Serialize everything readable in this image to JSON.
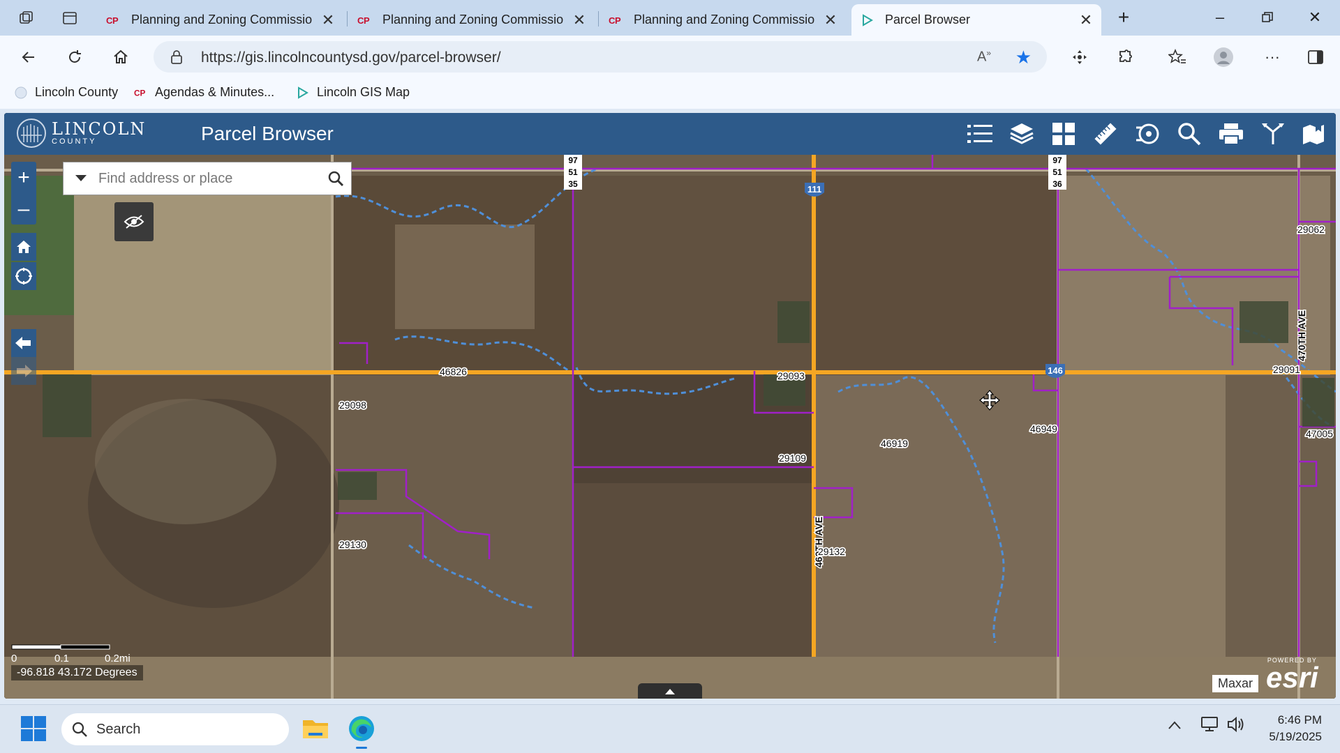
{
  "browser": {
    "tabs": [
      {
        "title": "Planning and Zoning Commissio",
        "favicon": "lincoln-cp-icon",
        "active": false
      },
      {
        "title": "Planning and Zoning Commissio",
        "favicon": "lincoln-cp-icon",
        "active": false
      },
      {
        "title": "Planning and Zoning Commissio",
        "favicon": "lincoln-cp-icon",
        "active": false
      },
      {
        "title": "Parcel Browser",
        "favicon": "gis-icon",
        "active": true
      }
    ],
    "url": "https://gis.lincolncountysd.gov/parcel-browser/",
    "read_aloud": "Aʹʹ",
    "bookmarks": [
      {
        "label": "Lincoln County"
      },
      {
        "label": "Agendas & Minutes..."
      },
      {
        "label": "Lincoln GIS Map"
      }
    ]
  },
  "app": {
    "logo_word": "LINCOLN",
    "logo_sub": "COUNTY",
    "title": "Parcel Browser",
    "header_color": "#2d5a8a"
  },
  "map": {
    "search_placeholder": "Find address or place",
    "parcel_labels": [
      "29098",
      "46826",
      "29093",
      "29062",
      "29091",
      "46949",
      "46919",
      "29109",
      "47005",
      "29130",
      "29132"
    ],
    "road_labels": [
      "469TH AVE",
      "470TH AVE"
    ],
    "shields": [
      "111",
      "146"
    ],
    "section_markers": [
      {
        "line1": "97",
        "line2": "51",
        "line3": "35"
      },
      {
        "line1": "97",
        "line2": "51",
        "line3": "36"
      }
    ],
    "scale": {
      "t0": "0",
      "t1": "0.1",
      "t2": "0.2mi"
    },
    "coordinates": "-96.818 43.172 Degrees",
    "attribution": "Maxar",
    "powered_by": "POWERED BY",
    "esri": "esri",
    "parcel_line_color": "#a020c8",
    "road_color": "#f5a623",
    "stream_color": "#4f8fd8"
  },
  "taskbar": {
    "search_label": "Search",
    "time": "6:46 PM",
    "date": "5/19/2025"
  }
}
